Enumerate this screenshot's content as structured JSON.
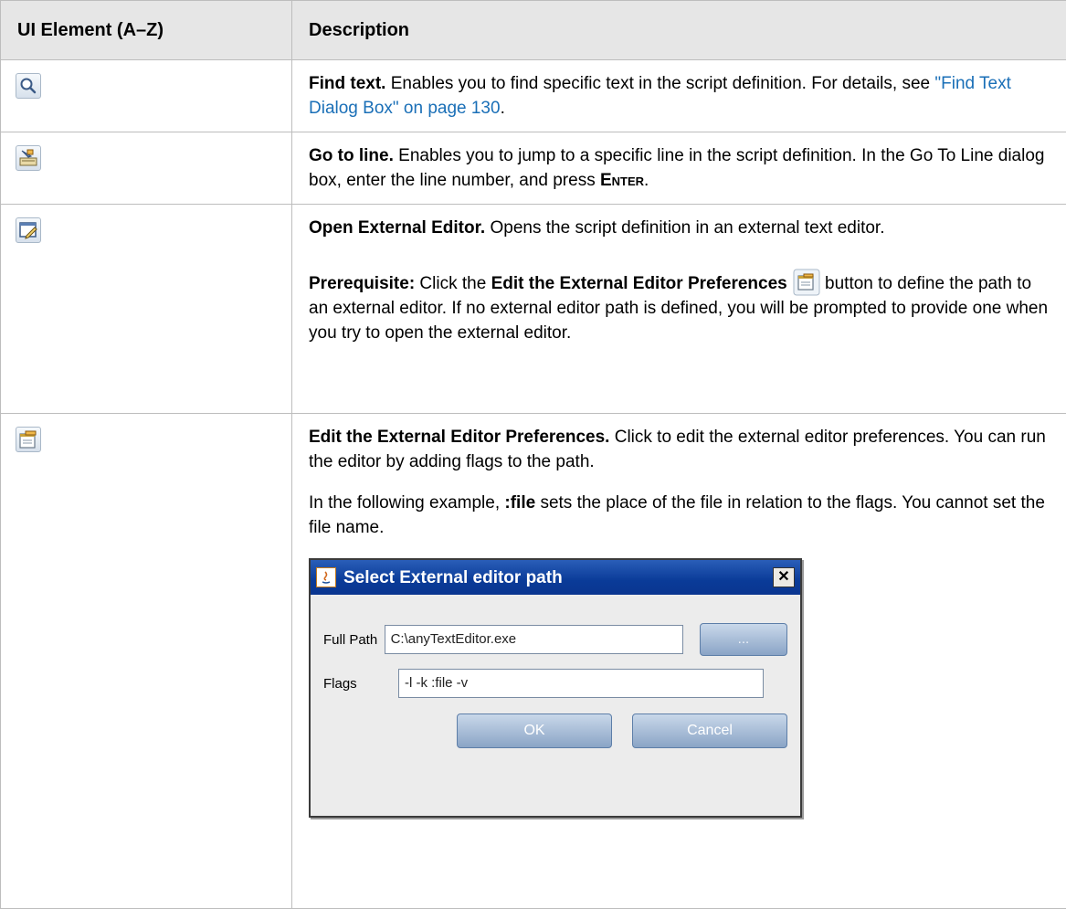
{
  "table": {
    "col_element": "UI Element (A–Z)",
    "col_description": "Description"
  },
  "rows": [
    {
      "icon": "find-text-icon",
      "title": "Find text.",
      "text": " Enables you to find specific text in the script definition. For details, see ",
      "link": "\"Find Text Dialog Box\" on page 130",
      "after": "."
    },
    {
      "icon": "go-to-line-icon",
      "title": "Go to line.",
      "text": " Enables you to jump to a specific line in the script definition. In the Go To Line dialog box, enter the line number, and press ",
      "key": "Enter",
      "after": "."
    },
    {
      "icon": "open-external-editor-icon",
      "title": "Open External Editor.",
      "text": " Opens the script definition in an external text editor.",
      "prereq_label": "Prerequisite:",
      "prereq_pre": " Click the ",
      "prereq_bold": "Edit the External Editor Preferences",
      "prereq_post": " button to define the path to an external editor. If no external editor path is defined, you will be prompted to provide one when you try to open the external editor."
    },
    {
      "icon": "edit-preferences-icon",
      "title": "Edit the External Editor Preferences.",
      "text": " Click to edit the external editor preferences. You can run the editor by adding flags to the path.",
      "ex_pre": "In the following example, ",
      "ex_bold": ":file",
      "ex_post": " sets the place of the file in relation to the flags. You cannot set the file name."
    }
  ],
  "dialog": {
    "title": "Select External editor path",
    "close": "✕",
    "full_path_label": "Full Path",
    "full_path_value": "C:\\anyTextEditor.exe",
    "browse_label": "...",
    "flags_label": "Flags",
    "flags_value": "-l -k :file -v",
    "ok_label": "OK",
    "cancel_label": "Cancel"
  },
  "colors": {
    "link": "#1a6fb7",
    "header_bg": "#e6e6e6",
    "dialog_title_bg": "#0a3b98"
  }
}
